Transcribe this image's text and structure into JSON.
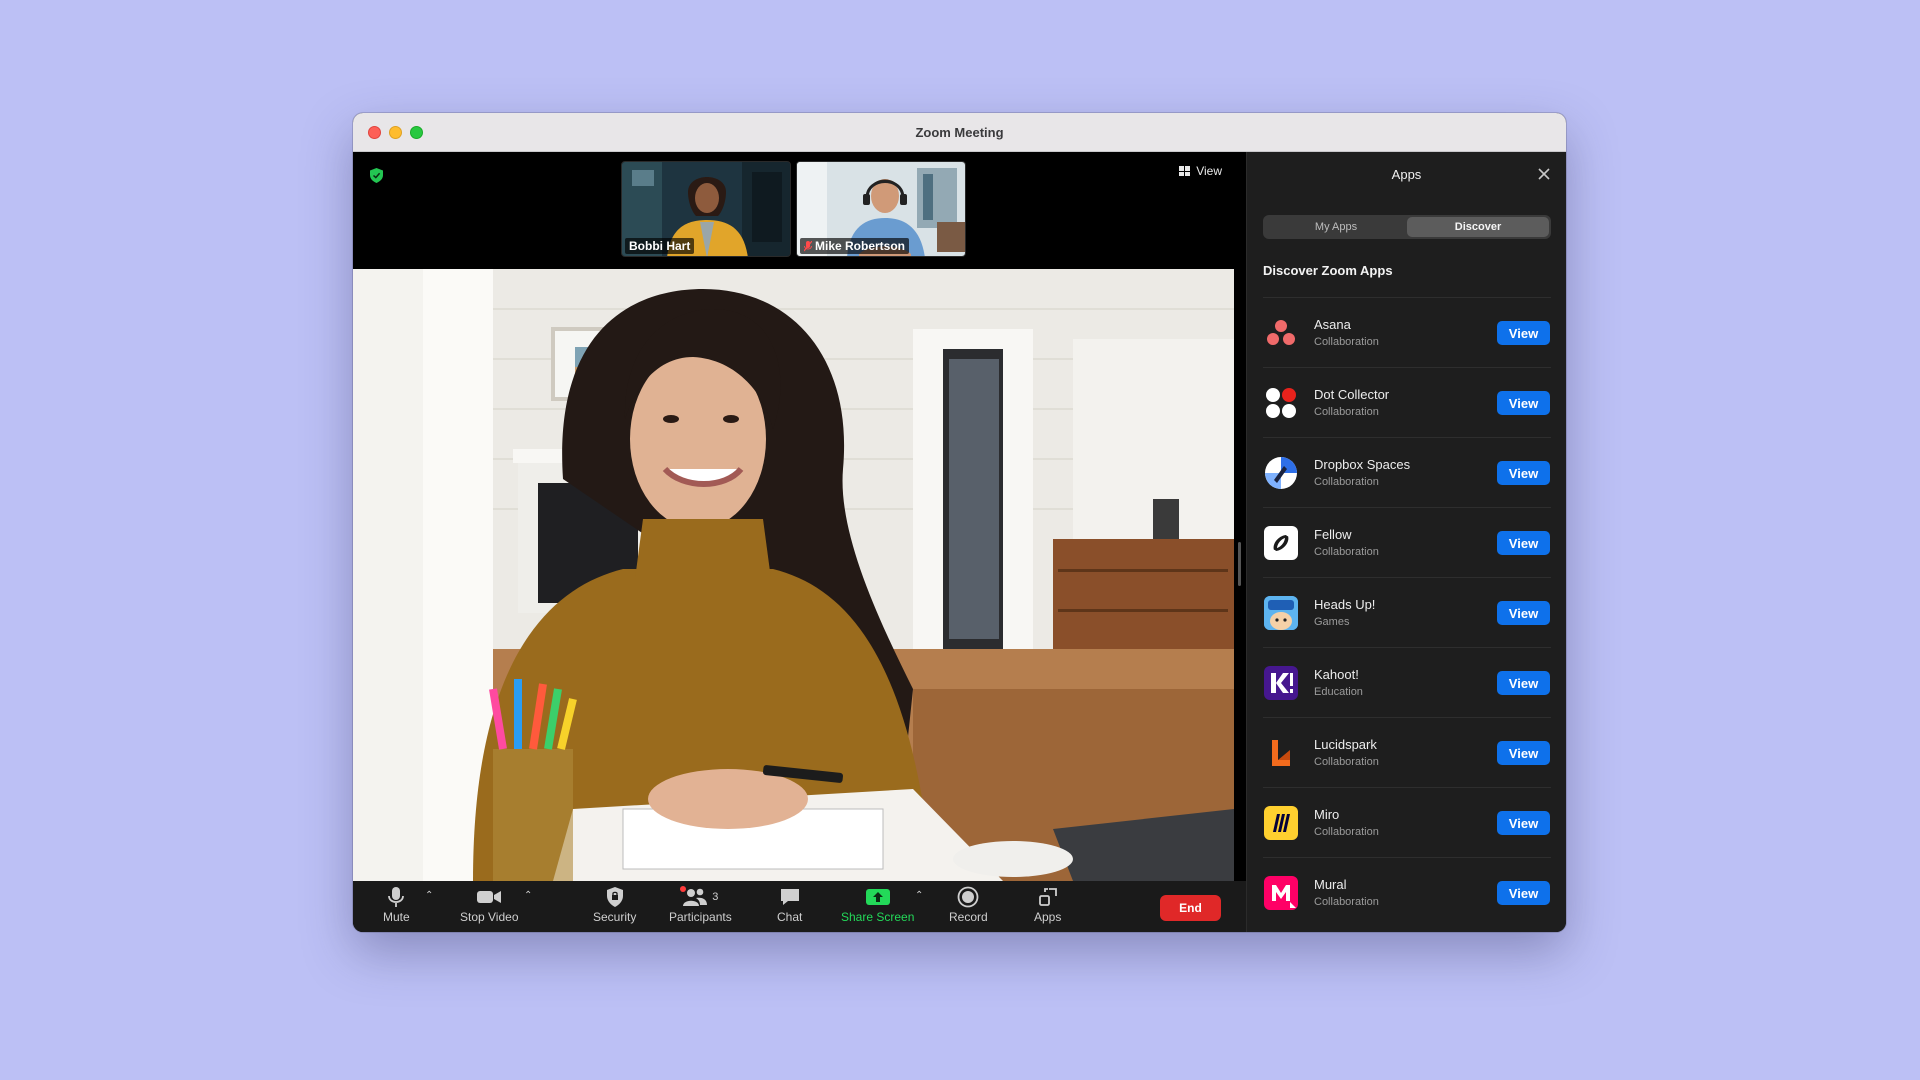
{
  "window": {
    "title": "Zoom Meeting"
  },
  "stage": {
    "view_label": "View",
    "participants": [
      {
        "name": "Bobbi Hart"
      },
      {
        "name": "Mike Robertson"
      }
    ]
  },
  "toolbar": {
    "mute": "Mute",
    "stop_video": "Stop Video",
    "security": "Security",
    "participants": "Participants",
    "participants_count": "3",
    "chat": "Chat",
    "share_screen": "Share Screen",
    "record": "Record",
    "apps": "Apps",
    "end": "End"
  },
  "panel": {
    "title": "Apps",
    "tabs": [
      {
        "label": "My Apps",
        "active": false
      },
      {
        "label": "Discover",
        "active": true
      }
    ],
    "heading": "Discover Zoom Apps",
    "view_label": "View",
    "apps": [
      {
        "name": "Asana",
        "category": "Collaboration",
        "icon": "asana-icon"
      },
      {
        "name": "Dot Collector",
        "category": "Collaboration",
        "icon": "dot-collector-icon"
      },
      {
        "name": "Dropbox Spaces",
        "category": "Collaboration",
        "icon": "dropbox-spaces-icon"
      },
      {
        "name": "Fellow",
        "category": "Collaboration",
        "icon": "fellow-icon"
      },
      {
        "name": "Heads Up!",
        "category": "Games",
        "icon": "heads-up-icon"
      },
      {
        "name": "Kahoot!",
        "category": "Education",
        "icon": "kahoot-icon"
      },
      {
        "name": "Lucidspark",
        "category": "Collaboration",
        "icon": "lucidspark-icon"
      },
      {
        "name": "Miro",
        "category": "Collaboration",
        "icon": "miro-icon"
      },
      {
        "name": "Mural",
        "category": "Collaboration",
        "icon": "mural-icon"
      }
    ]
  },
  "colors": {
    "background": "#bcc0f5",
    "accent_blue": "#0e71eb",
    "end_red": "#e02828",
    "share_green": "#23d959"
  }
}
